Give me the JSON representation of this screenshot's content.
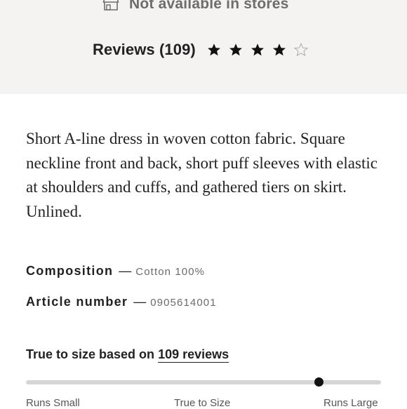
{
  "availability": {
    "text": "Not available in stores",
    "icon": "store-icon"
  },
  "reviews": {
    "label": "Reviews (109)",
    "rating": 4,
    "max_rating": 5,
    "star_icon": "star-icon"
  },
  "description": "Short A-line dress in woven cotton fabric. Square neckline front and back, short puff sleeves with elastic at shoulders and cuffs, and gathered tiers on skirt. Unlined.",
  "details": {
    "composition_label": "Composition",
    "composition_value": "Cotton 100%",
    "article_label": "Article number",
    "article_value": "0905614001",
    "separator": "—"
  },
  "fit": {
    "title_prefix": "True to size based on",
    "reviews_link": "109 reviews",
    "level": 0.825,
    "labels": [
      "Runs Small",
      "True to Size",
      "Runs Large"
    ]
  },
  "colors": {
    "panel_bg": "#f5f2f2",
    "text": "#222222",
    "muted": "#6b6b6b",
    "track": "#d6d4d4",
    "marker": "#111111"
  }
}
